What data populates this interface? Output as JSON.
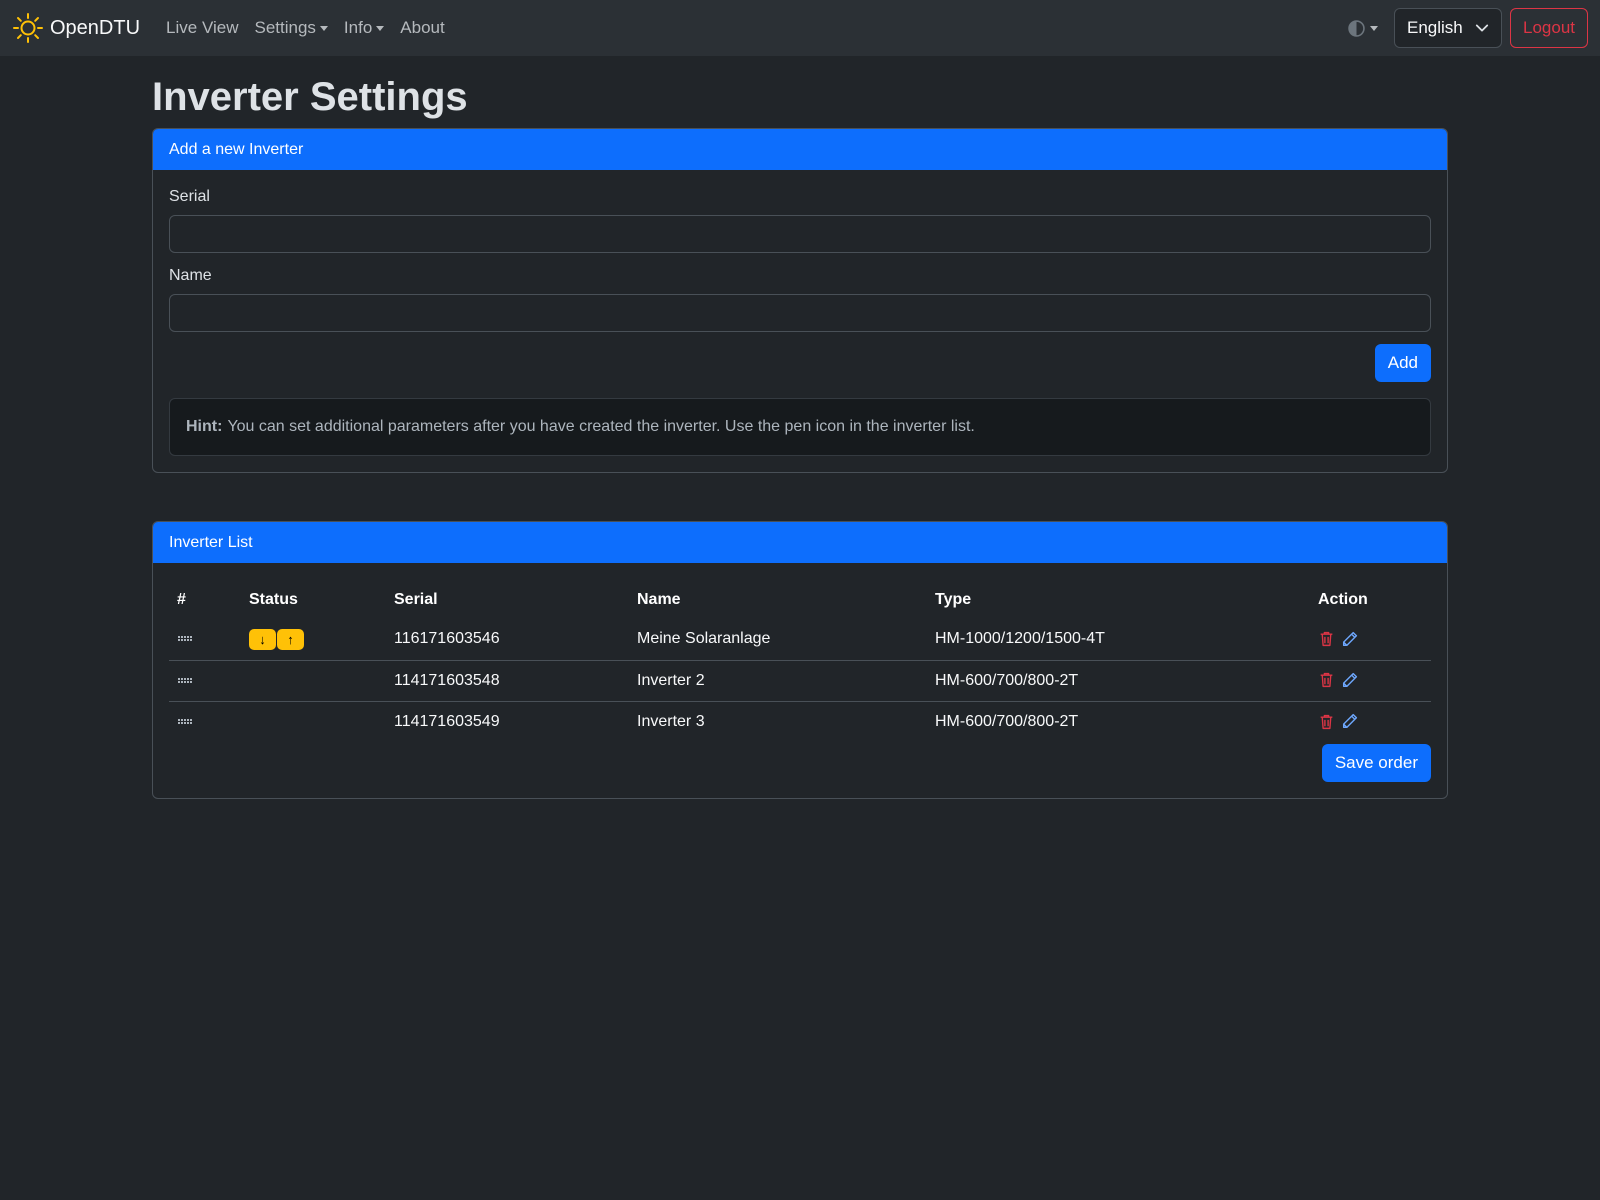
{
  "nav": {
    "brand": "OpenDTU",
    "items": [
      {
        "label": "Live View",
        "dropdown": false
      },
      {
        "label": "Settings",
        "dropdown": true
      },
      {
        "label": "Info",
        "dropdown": true
      },
      {
        "label": "About",
        "dropdown": false
      }
    ],
    "language": "English",
    "logout": "Logout"
  },
  "page": {
    "title": "Inverter Settings"
  },
  "add_card": {
    "header": "Add a new Inverter",
    "serial_label": "Serial",
    "serial_value": "",
    "name_label": "Name",
    "name_value": "",
    "add_button": "Add",
    "hint_bold": "Hint:",
    "hint_text": "You can set additional parameters after you have created the inverter. Use the pen icon in the inverter list."
  },
  "list_card": {
    "header": "Inverter List",
    "columns": [
      "#",
      "Status",
      "Serial",
      "Name",
      "Type",
      "Action"
    ],
    "rows": [
      {
        "status": [
          "↓",
          "↑"
        ],
        "serial": "116171603546",
        "name": "Meine Solaranlage",
        "type": "HM-1000/1200/1500-4T"
      },
      {
        "status": [],
        "serial": "114171603548",
        "name": "Inverter 2",
        "type": "HM-600/700/800-2T"
      },
      {
        "status": [],
        "serial": "114171603549",
        "name": "Inverter 3",
        "type": "HM-600/700/800-2T"
      }
    ],
    "save_button": "Save order"
  },
  "colors": {
    "primary": "#0d6efd",
    "danger": "#dc3545",
    "warning": "#ffc107",
    "background": "#212529"
  }
}
